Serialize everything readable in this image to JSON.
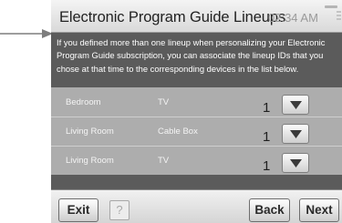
{
  "screen": {
    "title": "Electronic Program Guide Lineups",
    "clock": "02:34 AM"
  },
  "info": {
    "text": "If you defined more than one lineup when personalizing your Electronic Program Guide subscription, you can associate the lineup IDs that you chose at that time to the corresponding devices in the list below."
  },
  "lineups": [
    {
      "room": "Bedroom",
      "device": "TV",
      "lineup": "1"
    },
    {
      "room": "Living Room",
      "device": "Cable Box",
      "lineup": "1"
    },
    {
      "room": "Living Room",
      "device": "TV",
      "lineup": "1"
    }
  ],
  "buttons": {
    "exit": "Exit",
    "help": "?",
    "back": "Back",
    "next": "Next"
  },
  "icons": {
    "pointer": "callout-arrow-icon",
    "menu": "menu-icon",
    "dropdown": "dropdown-arrow-icon"
  },
  "colors": {
    "info_bg": "#5b5b5b",
    "table_bg": "#adadad",
    "bar_bg": "#e2e2e2"
  }
}
